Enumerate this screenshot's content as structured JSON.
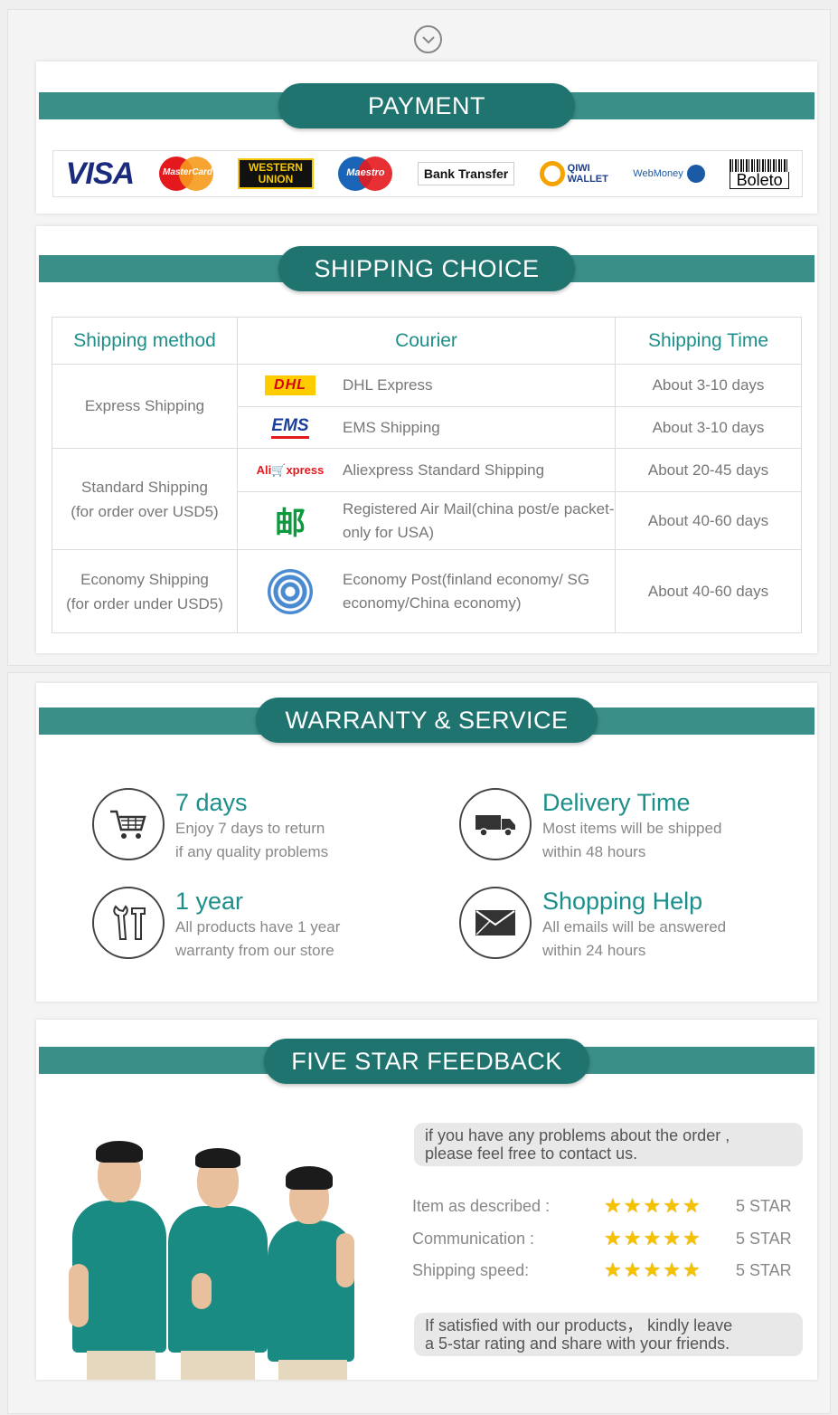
{
  "payment": {
    "title": "PAYMENT",
    "methods": {
      "visa": "VISA",
      "mastercard": "MasterCard",
      "western_union": [
        "WESTERN",
        "UNION"
      ],
      "maestro": "Maestro",
      "bank_transfer": "Bank Transfer",
      "qiwi": [
        "QIWI",
        "WALLET"
      ],
      "webmoney": "WebMoney",
      "boleto": "Boleto"
    }
  },
  "shipping": {
    "title": "SHIPPING CHOICE",
    "headers": [
      "Shipping method",
      "Courier",
      "Shipping Time"
    ],
    "groups": [
      {
        "method": [
          "Express Shipping"
        ],
        "rows": [
          {
            "logo": "DHL",
            "courier": "DHL Express",
            "time": "About 3-10 days"
          },
          {
            "logo": "EMS",
            "courier": "EMS Shipping",
            "time": "About 3-10 days"
          }
        ]
      },
      {
        "method": [
          "Standard Shipping",
          "(for order over USD5)"
        ],
        "rows": [
          {
            "logo": "AliExpress",
            "courier": "Aliexpress Standard Shipping",
            "time": "About 20-45 days"
          },
          {
            "logo": "China Post",
            "courier": "Registered Air Mail(china post/e packet-only for USA)",
            "time": "About 40-60 days"
          }
        ]
      },
      {
        "method": [
          "Economy Shipping",
          "(for order under USD5)"
        ],
        "rows": [
          {
            "logo": "UN",
            "courier": "Economy Post(finland economy/ SG economy/China economy)",
            "time": "About 40-60 days"
          }
        ]
      }
    ]
  },
  "warranty": {
    "title": "WARRANTY & SERVICE",
    "items": [
      {
        "title": "7  days",
        "lines": [
          "Enjoy 7 days to return",
          "if any quality problems"
        ],
        "icon": "cart-icon"
      },
      {
        "title": "Delivery Time",
        "lines": [
          "Most items will be shipped",
          "within 48 hours"
        ],
        "icon": "truck-icon"
      },
      {
        "title": "1  year",
        "lines": [
          "All products have 1 year",
          "warranty from our store"
        ],
        "icon": "tools-icon"
      },
      {
        "title": "Shopping Help",
        "lines": [
          "All emails will be answered",
          "within 24 hours"
        ],
        "icon": "envelope-icon"
      }
    ]
  },
  "feedback": {
    "title": "FIVE STAR FEEDBACK",
    "bubble_top": [
      "if you have any problems about the order ,",
      "please feel free to contact us."
    ],
    "ratings": [
      {
        "label": "Item as described :",
        "stars": 5,
        "value": "5 STAR"
      },
      {
        "label": "Communication :",
        "stars": 5,
        "value": "5 STAR"
      },
      {
        "label": "Shipping speed:",
        "stars": 5,
        "value": "5 STAR"
      }
    ],
    "bubble_bottom": [
      "If satisfied with our products， kindly leave",
      "a 5-star rating and share with your friends."
    ]
  },
  "colors": {
    "accent": "#1c8f8a",
    "banner": "#3a8f89",
    "pill": "#1f7470",
    "star": "#f5c200"
  }
}
